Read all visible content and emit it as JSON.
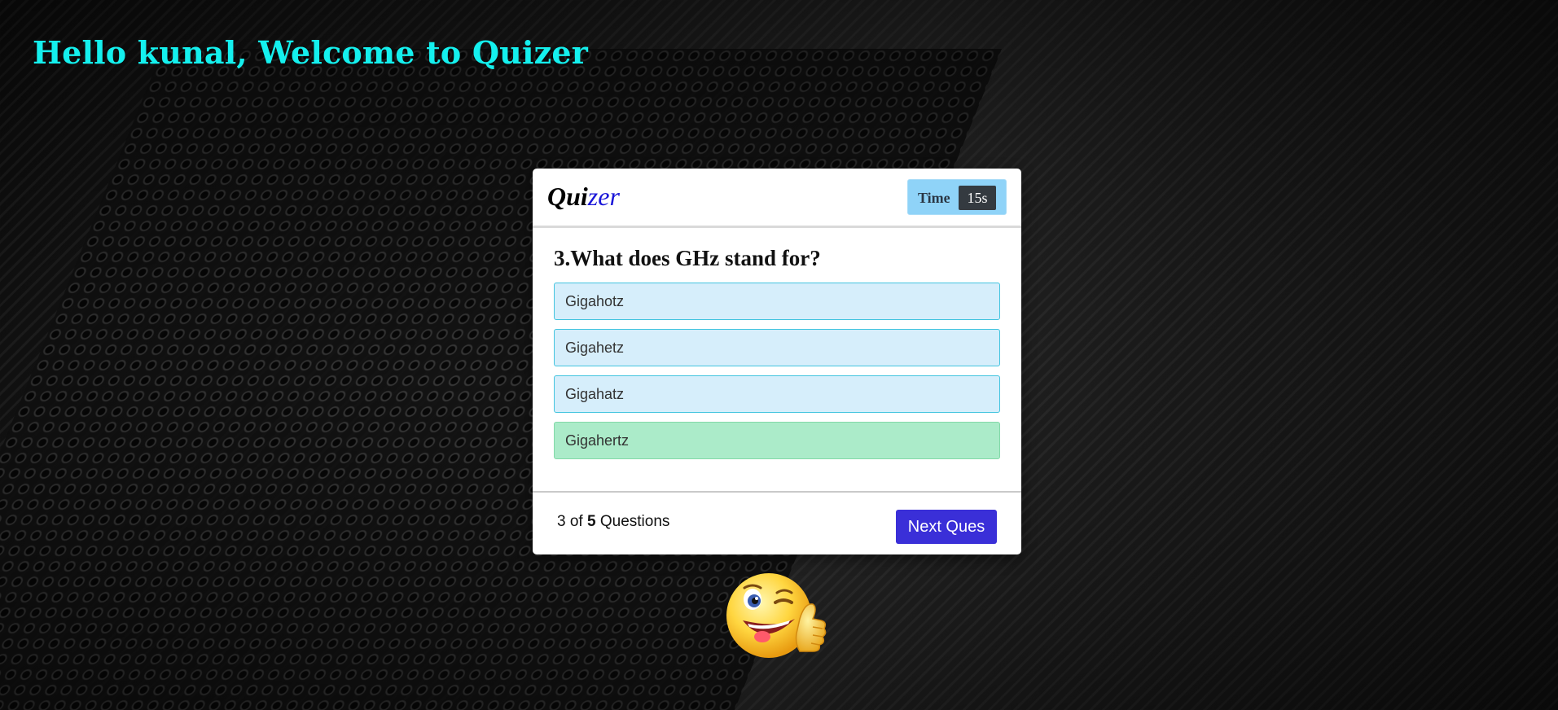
{
  "page": {
    "welcome_text": "Hello kunal, Welcome to Quizer"
  },
  "card": {
    "brand": {
      "prefix": "Qui",
      "suffix": "zer"
    },
    "timer": {
      "label": "Time",
      "value": "15s"
    },
    "question": {
      "text": "3.What does GHz stand for?"
    },
    "options": [
      {
        "text": "Gigahotz",
        "state": "default"
      },
      {
        "text": "Gigahetz",
        "state": "default"
      },
      {
        "text": "Gigahatz",
        "state": "default"
      },
      {
        "text": "Gigahertz",
        "state": "correct"
      }
    ],
    "footer": {
      "current": "3",
      "of_word": "of",
      "total": "5",
      "questions_word": "Questions",
      "next_label": "Next Ques"
    }
  },
  "decoration": {
    "mascot": "winking-thumbs-up-emoji-icon"
  },
  "colors": {
    "welcome": "#14f0ee",
    "brand_accent": "#1a16d8",
    "timer_bg": "#8fd3f8",
    "timer_value_bg": "#343a40",
    "option_bg": "#d6eefb",
    "option_border": "#43c4df",
    "correct_bg": "#abebc9",
    "next_button": "#3a2fd8"
  }
}
